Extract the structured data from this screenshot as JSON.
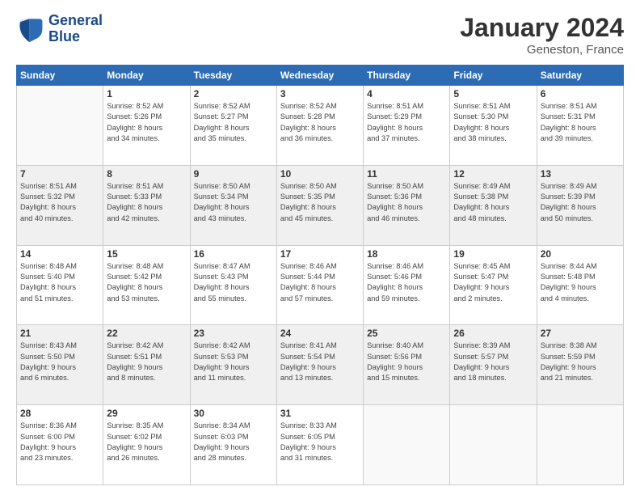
{
  "header": {
    "logo_line1": "General",
    "logo_line2": "Blue",
    "main_title": "January 2024",
    "subtitle": "Geneston, France"
  },
  "days_of_week": [
    "Sunday",
    "Monday",
    "Tuesday",
    "Wednesday",
    "Thursday",
    "Friday",
    "Saturday"
  ],
  "weeks": [
    [
      {
        "day": "",
        "sunrise": "",
        "sunset": "",
        "daylight": ""
      },
      {
        "day": "1",
        "sunrise": "Sunrise: 8:52 AM",
        "sunset": "Sunset: 5:26 PM",
        "daylight": "Daylight: 8 hours and 34 minutes."
      },
      {
        "day": "2",
        "sunrise": "Sunrise: 8:52 AM",
        "sunset": "Sunset: 5:27 PM",
        "daylight": "Daylight: 8 hours and 35 minutes."
      },
      {
        "day": "3",
        "sunrise": "Sunrise: 8:52 AM",
        "sunset": "Sunset: 5:28 PM",
        "daylight": "Daylight: 8 hours and 36 minutes."
      },
      {
        "day": "4",
        "sunrise": "Sunrise: 8:51 AM",
        "sunset": "Sunset: 5:29 PM",
        "daylight": "Daylight: 8 hours and 37 minutes."
      },
      {
        "day": "5",
        "sunrise": "Sunrise: 8:51 AM",
        "sunset": "Sunset: 5:30 PM",
        "daylight": "Daylight: 8 hours and 38 minutes."
      },
      {
        "day": "6",
        "sunrise": "Sunrise: 8:51 AM",
        "sunset": "Sunset: 5:31 PM",
        "daylight": "Daylight: 8 hours and 39 minutes."
      }
    ],
    [
      {
        "day": "7",
        "sunrise": "Sunrise: 8:51 AM",
        "sunset": "Sunset: 5:32 PM",
        "daylight": "Daylight: 8 hours and 40 minutes."
      },
      {
        "day": "8",
        "sunrise": "Sunrise: 8:51 AM",
        "sunset": "Sunset: 5:33 PM",
        "daylight": "Daylight: 8 hours and 42 minutes."
      },
      {
        "day": "9",
        "sunrise": "Sunrise: 8:50 AM",
        "sunset": "Sunset: 5:34 PM",
        "daylight": "Daylight: 8 hours and 43 minutes."
      },
      {
        "day": "10",
        "sunrise": "Sunrise: 8:50 AM",
        "sunset": "Sunset: 5:35 PM",
        "daylight": "Daylight: 8 hours and 45 minutes."
      },
      {
        "day": "11",
        "sunrise": "Sunrise: 8:50 AM",
        "sunset": "Sunset: 5:36 PM",
        "daylight": "Daylight: 8 hours and 46 minutes."
      },
      {
        "day": "12",
        "sunrise": "Sunrise: 8:49 AM",
        "sunset": "Sunset: 5:38 PM",
        "daylight": "Daylight: 8 hours and 48 minutes."
      },
      {
        "day": "13",
        "sunrise": "Sunrise: 8:49 AM",
        "sunset": "Sunset: 5:39 PM",
        "daylight": "Daylight: 8 hours and 50 minutes."
      }
    ],
    [
      {
        "day": "14",
        "sunrise": "Sunrise: 8:48 AM",
        "sunset": "Sunset: 5:40 PM",
        "daylight": "Daylight: 8 hours and 51 minutes."
      },
      {
        "day": "15",
        "sunrise": "Sunrise: 8:48 AM",
        "sunset": "Sunset: 5:42 PM",
        "daylight": "Daylight: 8 hours and 53 minutes."
      },
      {
        "day": "16",
        "sunrise": "Sunrise: 8:47 AM",
        "sunset": "Sunset: 5:43 PM",
        "daylight": "Daylight: 8 hours and 55 minutes."
      },
      {
        "day": "17",
        "sunrise": "Sunrise: 8:46 AM",
        "sunset": "Sunset: 5:44 PM",
        "daylight": "Daylight: 8 hours and 57 minutes."
      },
      {
        "day": "18",
        "sunrise": "Sunrise: 8:46 AM",
        "sunset": "Sunset: 5:46 PM",
        "daylight": "Daylight: 8 hours and 59 minutes."
      },
      {
        "day": "19",
        "sunrise": "Sunrise: 8:45 AM",
        "sunset": "Sunset: 5:47 PM",
        "daylight": "Daylight: 9 hours and 2 minutes."
      },
      {
        "day": "20",
        "sunrise": "Sunrise: 8:44 AM",
        "sunset": "Sunset: 5:48 PM",
        "daylight": "Daylight: 9 hours and 4 minutes."
      }
    ],
    [
      {
        "day": "21",
        "sunrise": "Sunrise: 8:43 AM",
        "sunset": "Sunset: 5:50 PM",
        "daylight": "Daylight: 9 hours and 6 minutes."
      },
      {
        "day": "22",
        "sunrise": "Sunrise: 8:42 AM",
        "sunset": "Sunset: 5:51 PM",
        "daylight": "Daylight: 9 hours and 8 minutes."
      },
      {
        "day": "23",
        "sunrise": "Sunrise: 8:42 AM",
        "sunset": "Sunset: 5:53 PM",
        "daylight": "Daylight: 9 hours and 11 minutes."
      },
      {
        "day": "24",
        "sunrise": "Sunrise: 8:41 AM",
        "sunset": "Sunset: 5:54 PM",
        "daylight": "Daylight: 9 hours and 13 minutes."
      },
      {
        "day": "25",
        "sunrise": "Sunrise: 8:40 AM",
        "sunset": "Sunset: 5:56 PM",
        "daylight": "Daylight: 9 hours and 15 minutes."
      },
      {
        "day": "26",
        "sunrise": "Sunrise: 8:39 AM",
        "sunset": "Sunset: 5:57 PM",
        "daylight": "Daylight: 9 hours and 18 minutes."
      },
      {
        "day": "27",
        "sunrise": "Sunrise: 8:38 AM",
        "sunset": "Sunset: 5:59 PM",
        "daylight": "Daylight: 9 hours and 21 minutes."
      }
    ],
    [
      {
        "day": "28",
        "sunrise": "Sunrise: 8:36 AM",
        "sunset": "Sunset: 6:00 PM",
        "daylight": "Daylight: 9 hours and 23 minutes."
      },
      {
        "day": "29",
        "sunrise": "Sunrise: 8:35 AM",
        "sunset": "Sunset: 6:02 PM",
        "daylight": "Daylight: 9 hours and 26 minutes."
      },
      {
        "day": "30",
        "sunrise": "Sunrise: 8:34 AM",
        "sunset": "Sunset: 6:03 PM",
        "daylight": "Daylight: 9 hours and 28 minutes."
      },
      {
        "day": "31",
        "sunrise": "Sunrise: 8:33 AM",
        "sunset": "Sunset: 6:05 PM",
        "daylight": "Daylight: 9 hours and 31 minutes."
      },
      {
        "day": "",
        "sunrise": "",
        "sunset": "",
        "daylight": ""
      },
      {
        "day": "",
        "sunrise": "",
        "sunset": "",
        "daylight": ""
      },
      {
        "day": "",
        "sunrise": "",
        "sunset": "",
        "daylight": ""
      }
    ]
  ]
}
